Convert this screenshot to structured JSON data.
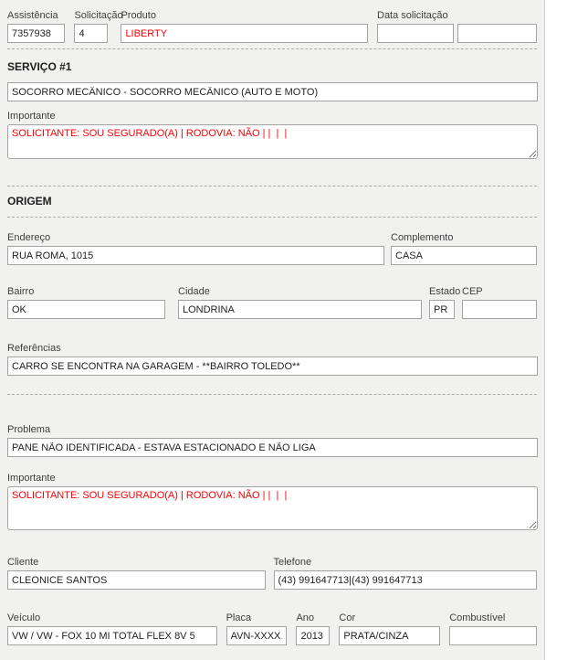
{
  "accent_colors": {
    "alert_text": "#ff0000",
    "panel_bg": "#f1f1f0",
    "input_border": "#a3a3a3"
  },
  "top": {
    "assistencia": {
      "label": "Assistência",
      "value": "7357938"
    },
    "solicitacao": {
      "label": "Solicitação",
      "value": "4"
    },
    "produto": {
      "label": "Produto",
      "value": "LIBERTY"
    },
    "data_solicitacao": {
      "label": "Data solicitação",
      "value_date": "",
      "value_time": ""
    }
  },
  "servico": {
    "heading": "SERVIÇO #1",
    "descricao": "SOCORRO MECÂNICO - SOCORRO MECÂNICO (AUTO E MOTO)",
    "importante": {
      "label": "Importante",
      "value": "SOLICITANTE: SOU SEGURADO(A) | RODOVIA: NÃO | |  |  |"
    }
  },
  "origem": {
    "heading": "ORIGEM",
    "endereco": {
      "label": "Endereço",
      "value": "RUA ROMA, 1015"
    },
    "complemento": {
      "label": "Complemento",
      "value": "CASA"
    },
    "bairro": {
      "label": "Bairro",
      "value": "OK"
    },
    "cidade": {
      "label": "Cidade",
      "value": "LONDRINA"
    },
    "estado": {
      "label": "Estado",
      "value": "PR"
    },
    "cep": {
      "label": "CEP",
      "value": ""
    },
    "referencias": {
      "label": "Referências",
      "value": "CARRO SE ENCONTRA NA GARAGEM - **BAIRRO TOLEDO**"
    }
  },
  "problema": {
    "label": "Problema",
    "value": "PANE NÃO IDENTIFICADA - ESTAVA ESTACIONADO E NÃO LIGA"
  },
  "importante2": {
    "label": "Importante",
    "value": "SOLICITANTE: SOU SEGURADO(A) | RODOVIA: NÃO | |  |  |"
  },
  "cliente": {
    "label": "Cliente",
    "value": "CLEONICE SANTOS"
  },
  "telefone": {
    "label": "Telefone",
    "value": "(43) 991647713|(43) 991647713"
  },
  "veiculo": {
    "veiculo": {
      "label": "Veículo",
      "value": "VW / VW - FOX 10 MI TOTAL FLEX 8V 5"
    },
    "placa": {
      "label": "Placa",
      "value": "AVN-XXXX"
    },
    "ano": {
      "label": "Ano",
      "value": "2013"
    },
    "cor": {
      "label": "Cor",
      "value": "PRATA/CINZA"
    },
    "combustivel": {
      "label": "Combustível",
      "value": ""
    }
  }
}
